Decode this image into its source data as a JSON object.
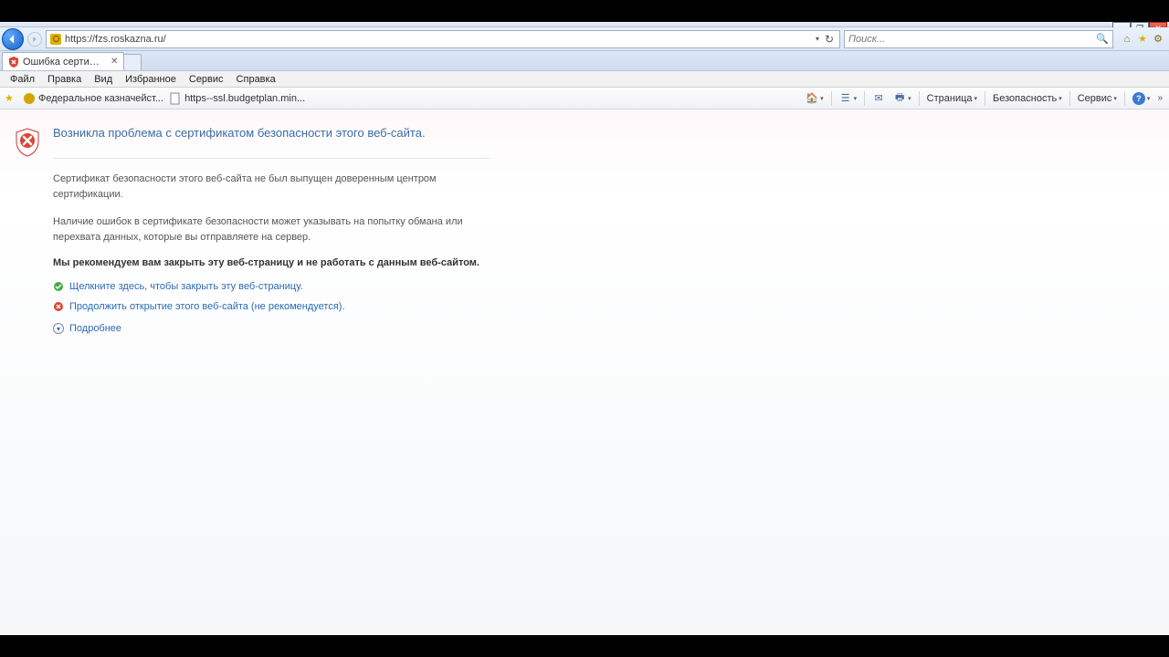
{
  "window_controls": {
    "min": "_",
    "max": "❐",
    "close": "✕"
  },
  "address_bar": {
    "url": "https://fzs.roskazna.ru/",
    "refresh_glyph": "↻",
    "dropdown_glyph": "▾"
  },
  "search": {
    "placeholder": "Поиск...",
    "magnifier": "🔍"
  },
  "right_util": {
    "home": "⌂",
    "star": "★",
    "gear": "⚙"
  },
  "tab": {
    "title": "Ошибка сертификата: пе...",
    "close": "✕"
  },
  "menubar": [
    "Файл",
    "Правка",
    "Вид",
    "Избранное",
    "Сервис",
    "Справка"
  ],
  "favorites": [
    {
      "label": "Федеральное казначейст..."
    },
    {
      "label": "https--ssl.budgetplan.min..."
    }
  ],
  "command_bar": {
    "page": "Страница",
    "security": "Безопасность",
    "service": "Сервис",
    "drop": "▾",
    "icons": {
      "home": "🏠",
      "feed": "☰",
      "mail": "✉",
      "print": "🖶"
    },
    "chevrons": "»"
  },
  "cert_error": {
    "title": "Возникла проблема с сертификатом безопасности этого веб-сайта.",
    "p1": "Сертификат безопасности этого веб-сайта не был выпущен доверенным центром сертификации.",
    "p2": "Наличие ошибок в сертификате безопасности может указывать на попытку обмана или перехвата данных, которые вы отправляете на сервер.",
    "recommend": "Мы рекомендуем вам закрыть эту веб-страницу и не работать с данным веб-сайтом.",
    "close_link": "Щелкните здесь, чтобы закрыть эту веб-страницу.",
    "continue_link": "Продолжить открытие этого веб-сайта (не рекомендуется).",
    "more": "Подробнее"
  }
}
